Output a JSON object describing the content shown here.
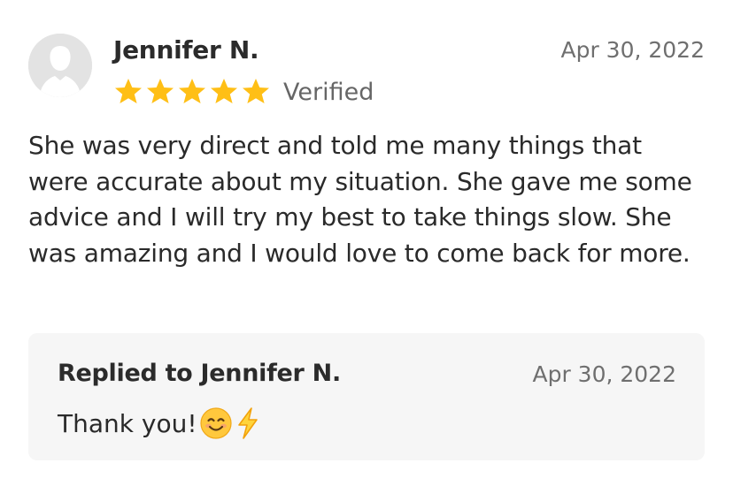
{
  "review": {
    "author": "Jennifer N.",
    "date": "Apr 30, 2022",
    "rating": 5,
    "rating_max": 5,
    "verified_label": "Verified",
    "body": "She was very direct and told me many things that were accurate about my situation. She gave me some advice and I will try my best to take things slow. She was amazing and I would love to come back for more.",
    "avatar_icon": "user-silhouette-icon",
    "star_icon": "star-icon",
    "star_color": "#FFBF16"
  },
  "reply": {
    "title": "Replied to Jennifer N.",
    "date": "Apr 30, 2022",
    "text": "Thank you!",
    "emojis": [
      "smiling-face-icon",
      "lightning-bolt-icon"
    ]
  }
}
